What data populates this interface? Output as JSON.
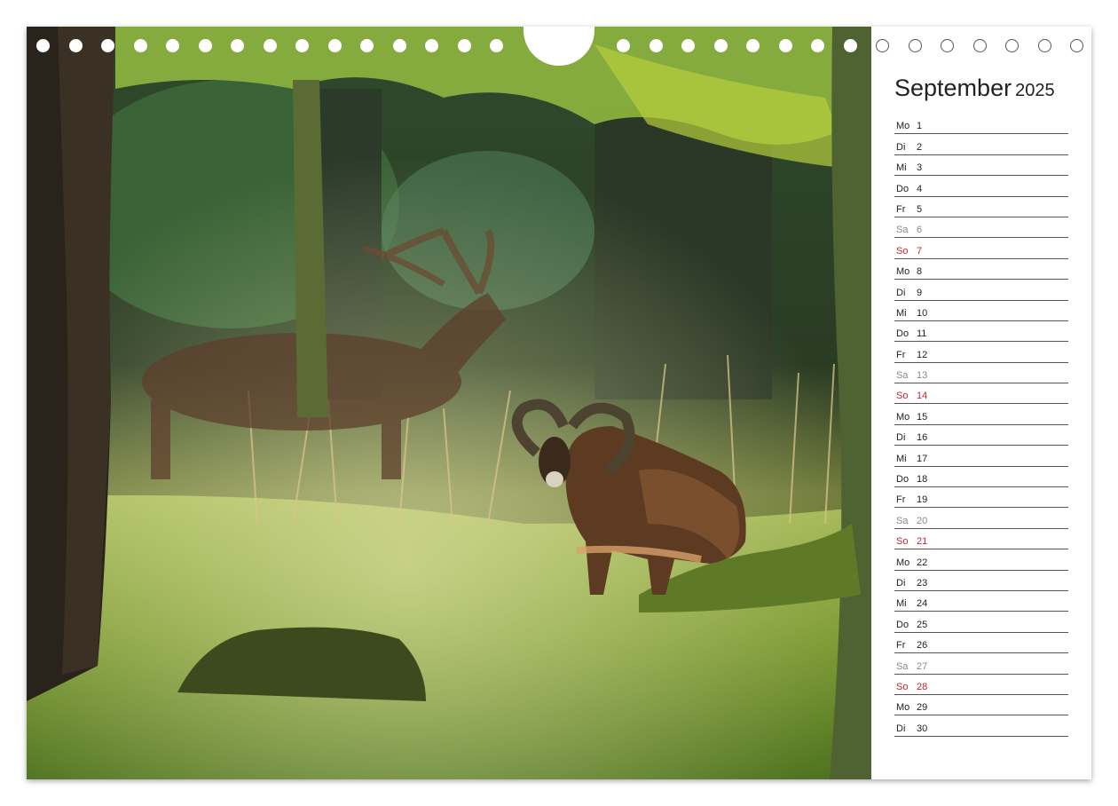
{
  "calendar": {
    "month": "September",
    "year": "2025",
    "days": [
      {
        "wd": "Mo",
        "d": "1",
        "type": "weekday"
      },
      {
        "wd": "Di",
        "d": "2",
        "type": "weekday"
      },
      {
        "wd": "Mi",
        "d": "3",
        "type": "weekday"
      },
      {
        "wd": "Do",
        "d": "4",
        "type": "weekday"
      },
      {
        "wd": "Fr",
        "d": "5",
        "type": "weekday"
      },
      {
        "wd": "Sa",
        "d": "6",
        "type": "saturday"
      },
      {
        "wd": "So",
        "d": "7",
        "type": "sunday"
      },
      {
        "wd": "Mo",
        "d": "8",
        "type": "weekday"
      },
      {
        "wd": "Di",
        "d": "9",
        "type": "weekday"
      },
      {
        "wd": "Mi",
        "d": "10",
        "type": "weekday"
      },
      {
        "wd": "Do",
        "d": "11",
        "type": "weekday"
      },
      {
        "wd": "Fr",
        "d": "12",
        "type": "weekday"
      },
      {
        "wd": "Sa",
        "d": "13",
        "type": "saturday"
      },
      {
        "wd": "So",
        "d": "14",
        "type": "sunday"
      },
      {
        "wd": "Mo",
        "d": "15",
        "type": "weekday"
      },
      {
        "wd": "Di",
        "d": "16",
        "type": "weekday"
      },
      {
        "wd": "Mi",
        "d": "17",
        "type": "weekday"
      },
      {
        "wd": "Do",
        "d": "18",
        "type": "weekday"
      },
      {
        "wd": "Fr",
        "d": "19",
        "type": "weekday"
      },
      {
        "wd": "Sa",
        "d": "20",
        "type": "saturday"
      },
      {
        "wd": "So",
        "d": "21",
        "type": "sunday"
      },
      {
        "wd": "Mo",
        "d": "22",
        "type": "weekday"
      },
      {
        "wd": "Di",
        "d": "23",
        "type": "weekday"
      },
      {
        "wd": "Mi",
        "d": "24",
        "type": "weekday"
      },
      {
        "wd": "Do",
        "d": "25",
        "type": "weekday"
      },
      {
        "wd": "Fr",
        "d": "26",
        "type": "weekday"
      },
      {
        "wd": "Sa",
        "d": "27",
        "type": "saturday"
      },
      {
        "wd": "So",
        "d": "28",
        "type": "sunday"
      },
      {
        "wd": "Mo",
        "d": "29",
        "type": "weekday"
      },
      {
        "wd": "Di",
        "d": "30",
        "type": "weekday"
      }
    ]
  },
  "colors": {
    "sunday": "#c0262c",
    "saturday": "#888888",
    "weekday": "#222222"
  },
  "photo": {
    "subject": "mouflon-and-red-deer-in-forest"
  }
}
